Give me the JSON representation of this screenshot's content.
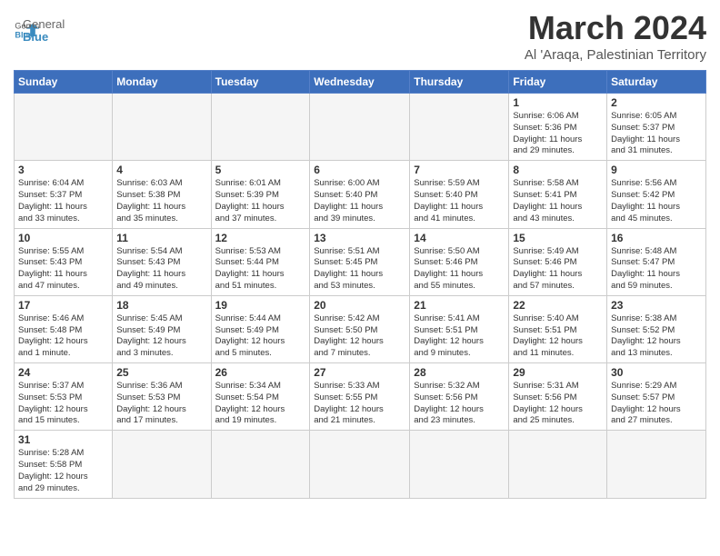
{
  "header": {
    "logo_general": "General",
    "logo_blue": "Blue",
    "title": "March 2024",
    "subtitle": "Al 'Araqa, Palestinian Territory"
  },
  "weekdays": [
    "Sunday",
    "Monday",
    "Tuesday",
    "Wednesday",
    "Thursday",
    "Friday",
    "Saturday"
  ],
  "weeks": [
    [
      {
        "day": "",
        "info": ""
      },
      {
        "day": "",
        "info": ""
      },
      {
        "day": "",
        "info": ""
      },
      {
        "day": "",
        "info": ""
      },
      {
        "day": "",
        "info": ""
      },
      {
        "day": "1",
        "info": "Sunrise: 6:06 AM\nSunset: 5:36 PM\nDaylight: 11 hours\nand 29 minutes."
      },
      {
        "day": "2",
        "info": "Sunrise: 6:05 AM\nSunset: 5:37 PM\nDaylight: 11 hours\nand 31 minutes."
      }
    ],
    [
      {
        "day": "3",
        "info": "Sunrise: 6:04 AM\nSunset: 5:37 PM\nDaylight: 11 hours\nand 33 minutes."
      },
      {
        "day": "4",
        "info": "Sunrise: 6:03 AM\nSunset: 5:38 PM\nDaylight: 11 hours\nand 35 minutes."
      },
      {
        "day": "5",
        "info": "Sunrise: 6:01 AM\nSunset: 5:39 PM\nDaylight: 11 hours\nand 37 minutes."
      },
      {
        "day": "6",
        "info": "Sunrise: 6:00 AM\nSunset: 5:40 PM\nDaylight: 11 hours\nand 39 minutes."
      },
      {
        "day": "7",
        "info": "Sunrise: 5:59 AM\nSunset: 5:40 PM\nDaylight: 11 hours\nand 41 minutes."
      },
      {
        "day": "8",
        "info": "Sunrise: 5:58 AM\nSunset: 5:41 PM\nDaylight: 11 hours\nand 43 minutes."
      },
      {
        "day": "9",
        "info": "Sunrise: 5:56 AM\nSunset: 5:42 PM\nDaylight: 11 hours\nand 45 minutes."
      }
    ],
    [
      {
        "day": "10",
        "info": "Sunrise: 5:55 AM\nSunset: 5:43 PM\nDaylight: 11 hours\nand 47 minutes."
      },
      {
        "day": "11",
        "info": "Sunrise: 5:54 AM\nSunset: 5:43 PM\nDaylight: 11 hours\nand 49 minutes."
      },
      {
        "day": "12",
        "info": "Sunrise: 5:53 AM\nSunset: 5:44 PM\nDaylight: 11 hours\nand 51 minutes."
      },
      {
        "day": "13",
        "info": "Sunrise: 5:51 AM\nSunset: 5:45 PM\nDaylight: 11 hours\nand 53 minutes."
      },
      {
        "day": "14",
        "info": "Sunrise: 5:50 AM\nSunset: 5:46 PM\nDaylight: 11 hours\nand 55 minutes."
      },
      {
        "day": "15",
        "info": "Sunrise: 5:49 AM\nSunset: 5:46 PM\nDaylight: 11 hours\nand 57 minutes."
      },
      {
        "day": "16",
        "info": "Sunrise: 5:48 AM\nSunset: 5:47 PM\nDaylight: 11 hours\nand 59 minutes."
      }
    ],
    [
      {
        "day": "17",
        "info": "Sunrise: 5:46 AM\nSunset: 5:48 PM\nDaylight: 12 hours\nand 1 minute."
      },
      {
        "day": "18",
        "info": "Sunrise: 5:45 AM\nSunset: 5:49 PM\nDaylight: 12 hours\nand 3 minutes."
      },
      {
        "day": "19",
        "info": "Sunrise: 5:44 AM\nSunset: 5:49 PM\nDaylight: 12 hours\nand 5 minutes."
      },
      {
        "day": "20",
        "info": "Sunrise: 5:42 AM\nSunset: 5:50 PM\nDaylight: 12 hours\nand 7 minutes."
      },
      {
        "day": "21",
        "info": "Sunrise: 5:41 AM\nSunset: 5:51 PM\nDaylight: 12 hours\nand 9 minutes."
      },
      {
        "day": "22",
        "info": "Sunrise: 5:40 AM\nSunset: 5:51 PM\nDaylight: 12 hours\nand 11 minutes."
      },
      {
        "day": "23",
        "info": "Sunrise: 5:38 AM\nSunset: 5:52 PM\nDaylight: 12 hours\nand 13 minutes."
      }
    ],
    [
      {
        "day": "24",
        "info": "Sunrise: 5:37 AM\nSunset: 5:53 PM\nDaylight: 12 hours\nand 15 minutes."
      },
      {
        "day": "25",
        "info": "Sunrise: 5:36 AM\nSunset: 5:53 PM\nDaylight: 12 hours\nand 17 minutes."
      },
      {
        "day": "26",
        "info": "Sunrise: 5:34 AM\nSunset: 5:54 PM\nDaylight: 12 hours\nand 19 minutes."
      },
      {
        "day": "27",
        "info": "Sunrise: 5:33 AM\nSunset: 5:55 PM\nDaylight: 12 hours\nand 21 minutes."
      },
      {
        "day": "28",
        "info": "Sunrise: 5:32 AM\nSunset: 5:56 PM\nDaylight: 12 hours\nand 23 minutes."
      },
      {
        "day": "29",
        "info": "Sunrise: 5:31 AM\nSunset: 5:56 PM\nDaylight: 12 hours\nand 25 minutes."
      },
      {
        "day": "30",
        "info": "Sunrise: 5:29 AM\nSunset: 5:57 PM\nDaylight: 12 hours\nand 27 minutes."
      }
    ],
    [
      {
        "day": "31",
        "info": "Sunrise: 5:28 AM\nSunset: 5:58 PM\nDaylight: 12 hours\nand 29 minutes."
      },
      {
        "day": "",
        "info": ""
      },
      {
        "day": "",
        "info": ""
      },
      {
        "day": "",
        "info": ""
      },
      {
        "day": "",
        "info": ""
      },
      {
        "day": "",
        "info": ""
      },
      {
        "day": "",
        "info": ""
      }
    ]
  ]
}
